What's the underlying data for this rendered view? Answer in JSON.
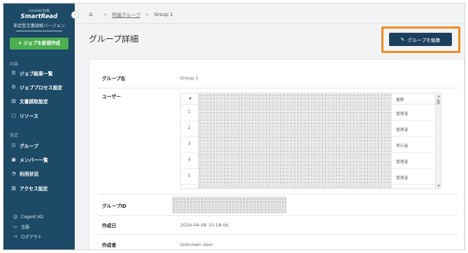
{
  "sidebar": {
    "brand_top": "COGENT社製",
    "brand_name": "SmartRead",
    "brand_sub": "非定型文書読取バージョン",
    "collapse_glyph": "‹",
    "new_job_label": "+ ジョブを新規作成",
    "section_content": "内容",
    "section_settings": "設定",
    "items": [
      {
        "label": "ジョブ結果一覧",
        "icon": "list-icon",
        "glyph": "☰"
      },
      {
        "label": "ジョブプロセス設定",
        "icon": "process-icon",
        "glyph": "⚙"
      },
      {
        "label": "文書読取設定",
        "icon": "document-icon",
        "glyph": "▤"
      },
      {
        "label": "リソース",
        "icon": "resource-icon",
        "glyph": "▢"
      },
      {
        "label": "グループ",
        "icon": "group-icon",
        "glyph": "☷"
      },
      {
        "label": "メンバー一覧",
        "icon": "member-icon",
        "glyph": "▣"
      },
      {
        "label": "利用状況",
        "icon": "usage-icon",
        "glyph": "◔"
      },
      {
        "label": "アクセス設定",
        "icon": "access-icon",
        "glyph": "▥"
      }
    ],
    "footer": [
      {
        "label": "Cogent AD",
        "icon": "user-icon",
        "glyph": "☺"
      },
      {
        "label": "言語",
        "icon": "language-icon",
        "glyph": "▭"
      },
      {
        "label": "ログアウト",
        "icon": "logout-icon",
        "glyph": "↪"
      }
    ]
  },
  "breadcrumb": {
    "home_glyph": "⌂",
    "sep": ">",
    "parent": "所属グループ",
    "current": "Group 1"
  },
  "page": {
    "title": "グループ詳細",
    "edit_button": "グループを編集",
    "edit_glyph": "✎"
  },
  "details": {
    "group_name_label": "グループ名",
    "group_name_value": "Group 1",
    "users_label": "ユーザー",
    "users_table": {
      "col_num": "#",
      "col_role": "権限",
      "rows": [
        {
          "num": "1",
          "role": "管理者"
        },
        {
          "num": "2",
          "role": "管理者"
        },
        {
          "num": "3",
          "role": "実行者"
        },
        {
          "num": "4",
          "role": "管理者"
        },
        {
          "num": "5",
          "role": "管理者"
        }
      ]
    },
    "group_id_label": "グループID",
    "created_at_label": "作成日",
    "created_at_value": "2024-04-08 10:18:06",
    "creator_label": "作成者",
    "creator_value": "Unknown User"
  },
  "colors": {
    "sidebar_bg": "#1d4a66",
    "new_job_green": "#4caf50",
    "edit_button_bg": "#1d3f5e",
    "highlight_orange": "#f08a22"
  }
}
